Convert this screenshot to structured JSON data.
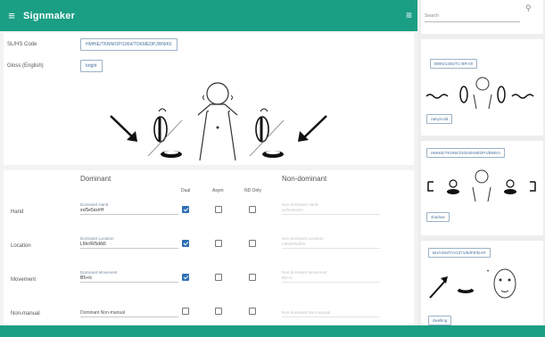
{
  "app": {
    "title": "Signmaker"
  },
  "fields": {
    "code_label": "SL/HS Code",
    "code_value": "HMHIE/TKNNIOP/1004/TOKMEDPJ/BN/KII",
    "gloss_label": "Gloss (English)",
    "gloss_value": "bright"
  },
  "params": {
    "dominant_title": "Dominant",
    "nondominant_title": "Non-dominant",
    "sub_headers": [
      "Dual",
      "Asym",
      "ND Only"
    ],
    "rows": [
      {
        "label": "Hand",
        "small": "Dominant Hand",
        "value": "xx/5e5xx/rH",
        "dual": true,
        "asym": false,
        "nd": false,
        "nd_small": "Non-dominant Hand",
        "nd_value": "xx/5e5xx/rH"
      },
      {
        "label": "Location",
        "small": "Dominant Location",
        "value": "L5hr/R/5d/b5",
        "dual": true,
        "asym": false,
        "nd": false,
        "nd_small": "Non-dominant Location",
        "nd_value": "L5hr/R/5d/b5"
      },
      {
        "label": "Movement",
        "small": "Dominant Movement",
        "value": "B5+/s",
        "dual": true,
        "asym": false,
        "nd": false,
        "nd_small": "Non-dominant Movement",
        "nd_value": "B5+/s"
      },
      {
        "label": "Non-manual",
        "small": "",
        "value": "Dominant Non-manual",
        "dual": false,
        "asym": false,
        "nd": false,
        "nd_small": "",
        "nd_value": "Non-dominant Non-manual"
      }
    ]
  },
  "sidebar": {
    "search_placeholder": "Search",
    "results": [
      {
        "code": "BWN/1405/TC-BR-I/0",
        "gloss": "rainy/cold"
      },
      {
        "code": "HMHIE/TKNNIO/1004/KMEDPJ/BN/KII",
        "gloss": "shadow"
      },
      {
        "code": "BH/HOMT/A/1371/BI/FE/DAR",
        "gloss": "dwelling"
      }
    ]
  },
  "colors": {
    "accent": "#1a9e84",
    "check": "#2f6fb5",
    "chip_border": "#9bb2c7"
  }
}
